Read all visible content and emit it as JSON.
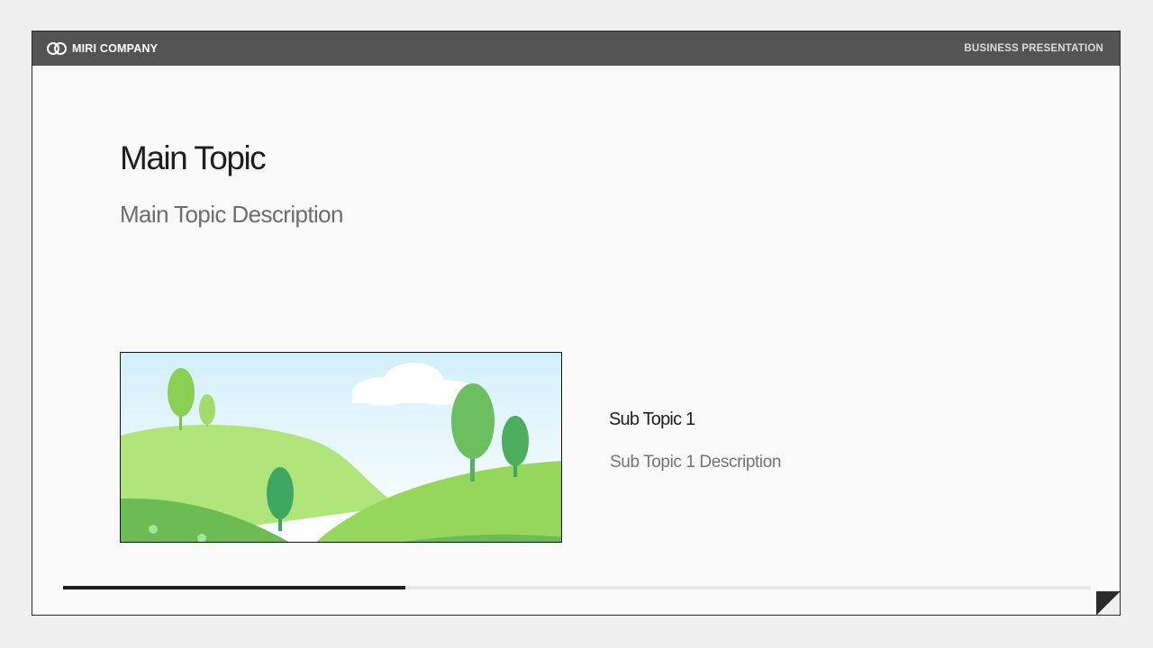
{
  "header": {
    "brand_name": "MIRI COMPANY",
    "brand_icon": "miri-rings-logo",
    "section_label": "BUSINESS PRESENTATION"
  },
  "main": {
    "title": "Main Topic",
    "description": "Main Topic Description"
  },
  "subtopic": {
    "title": "Sub Topic 1",
    "description": "Sub Topic 1 Description"
  },
  "illustration": {
    "subject": "green-hills-with-trees"
  },
  "progress": {
    "fraction": 0.333
  },
  "colors": {
    "header_bg": "#545454",
    "slide_bg": "#f9f9fa",
    "accent_dark": "#1d1d1d",
    "hill_light": "#b0e57c",
    "hill_mid": "#97d65d",
    "hill_dark": "#6cbb53",
    "tree_dark": "#3ea862"
  }
}
